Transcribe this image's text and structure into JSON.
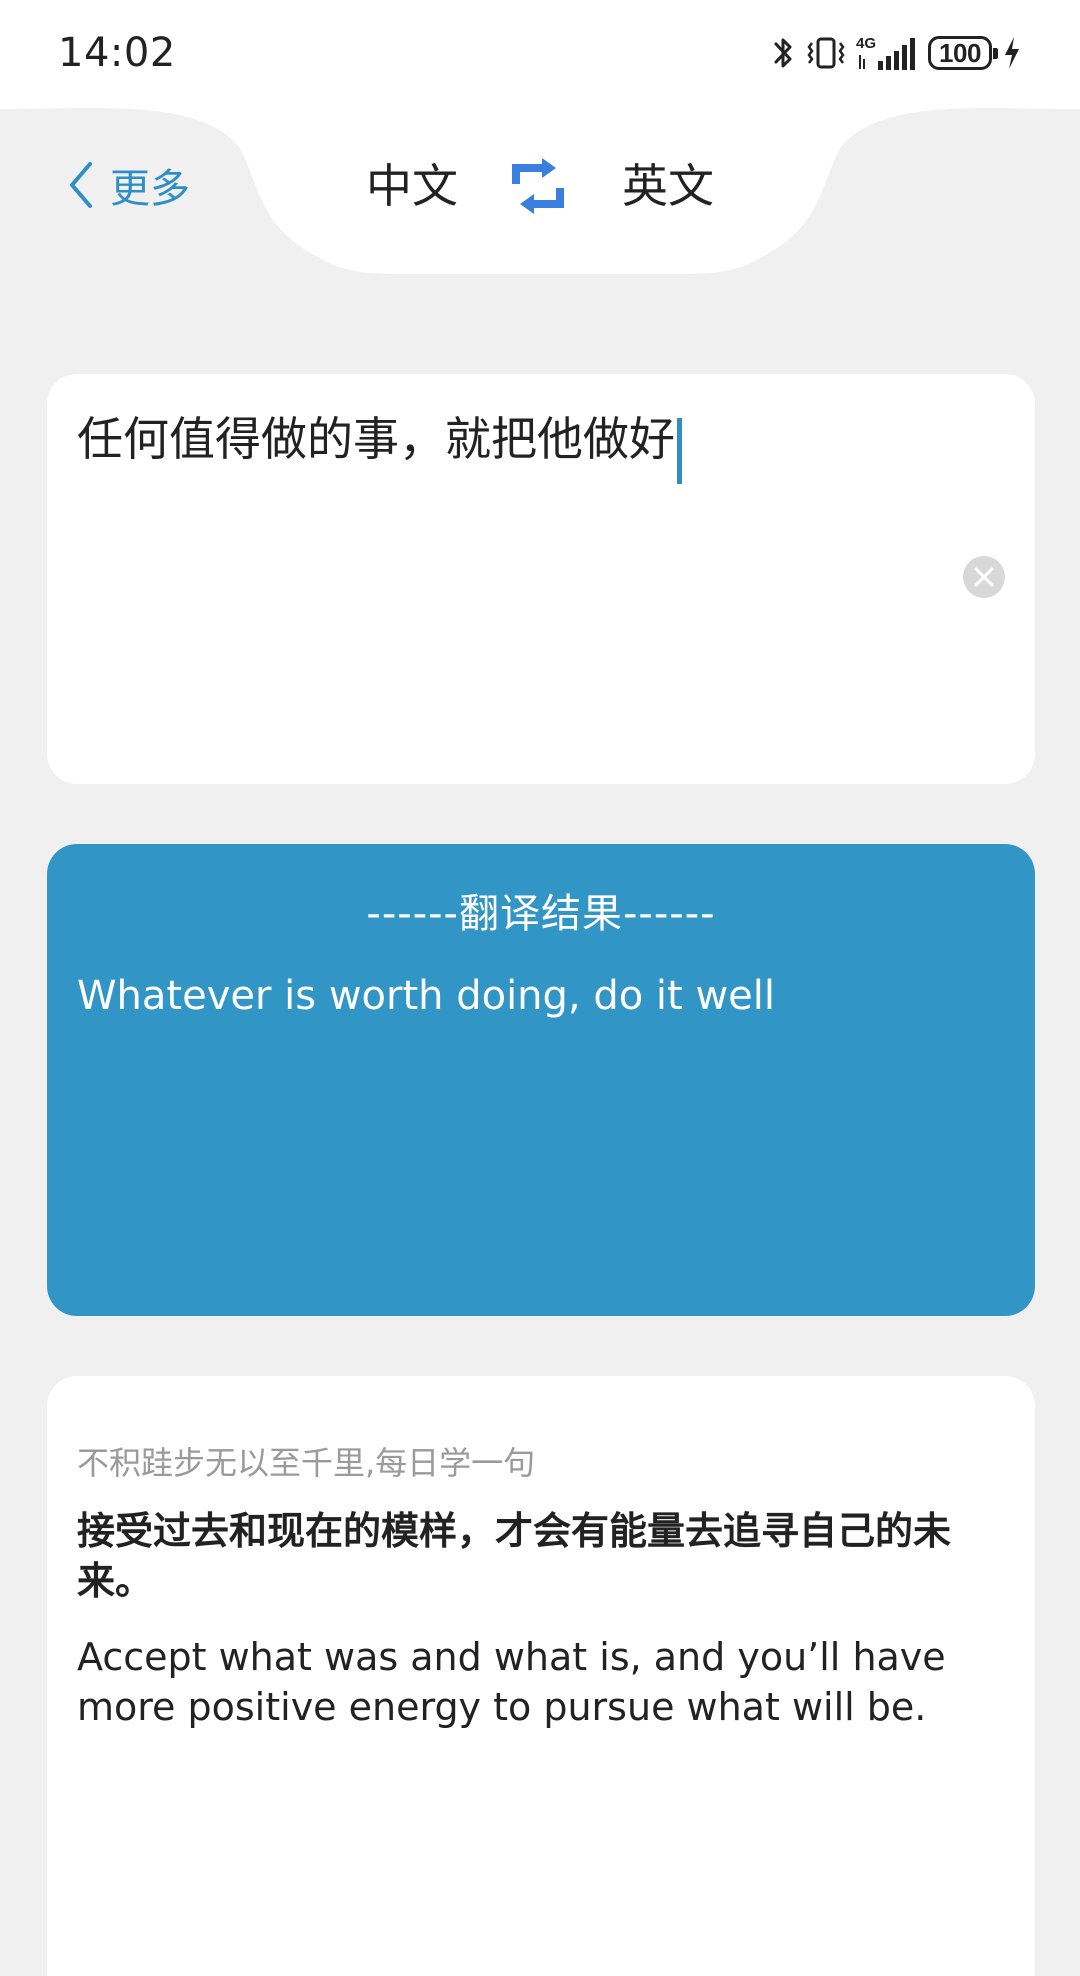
{
  "status_bar": {
    "time": "14:02",
    "battery": "100",
    "network": "4G",
    "icons": [
      "bluetooth-icon",
      "vibrate-icon",
      "signal-icon",
      "battery-icon",
      "charging-icon"
    ]
  },
  "header": {
    "back_label": "更多",
    "source_lang": "中文",
    "target_lang": "英文"
  },
  "input": {
    "text": "任何值得做的事，就把他做好"
  },
  "result": {
    "heading": "------翻译结果------",
    "text": "Whatever is worth doing, do it well"
  },
  "daily": {
    "caption": "不积跬步无以至千里,每日学一句",
    "sentence_cn": "接受过去和现在的模样，才会有能量去追寻自己的未来。",
    "sentence_en": "Accept what was and what is, and you’ll have more positive energy to pursue what will be."
  },
  "colors": {
    "accent": "#2f8fc5",
    "result_bg": "#3195c6",
    "swap_icon": "#3a7fe0",
    "page_bg": "#f0f0f0"
  }
}
